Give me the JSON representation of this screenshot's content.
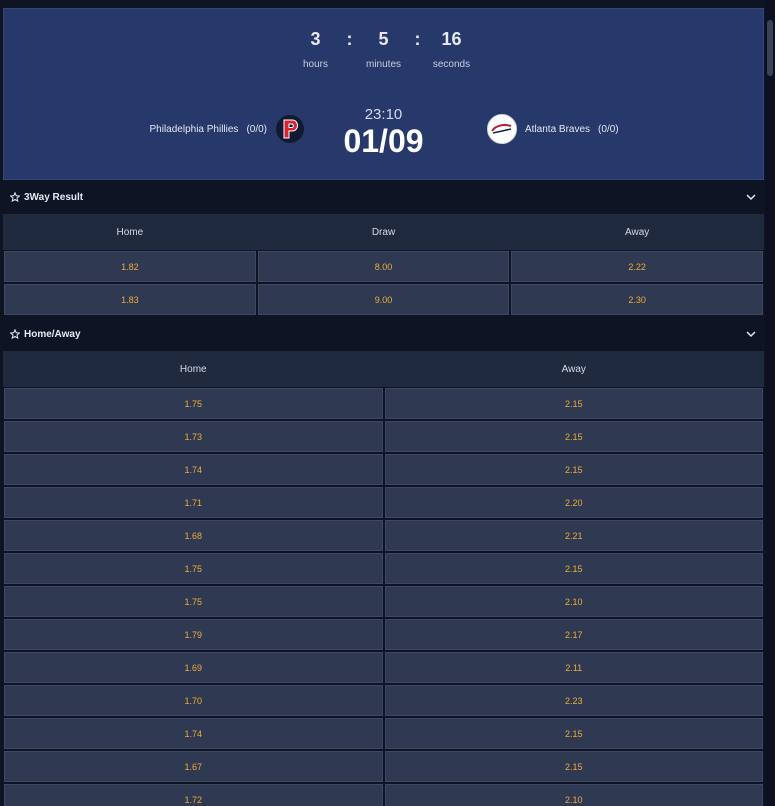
{
  "countdown": {
    "hours": "3",
    "minutes": "5",
    "seconds": "16",
    "hours_label": "hours",
    "minutes_label": "minutes",
    "seconds_label": "seconds",
    "separator": ":"
  },
  "match": {
    "home_team": "Philadelphia Phillies",
    "home_record": "(0/0)",
    "away_team": "Atlanta Braves",
    "away_record": "(0/0)",
    "time": "23:10",
    "date": "01/09"
  },
  "markets": {
    "three_way": {
      "title": "3Way Result",
      "columns": [
        "Home",
        "Draw",
        "Away"
      ],
      "rows": [
        [
          "1.82",
          "8.00",
          "2.22"
        ],
        [
          "1.83",
          "9.00",
          "2.30"
        ]
      ]
    },
    "home_away": {
      "title": "Home/Away",
      "columns": [
        "Home",
        "Away"
      ],
      "rows": [
        [
          "1.75",
          "2.15"
        ],
        [
          "1.73",
          "2.15"
        ],
        [
          "1.74",
          "2.15"
        ],
        [
          "1.71",
          "2.20"
        ],
        [
          "1.68",
          "2.21"
        ],
        [
          "1.75",
          "2.15"
        ],
        [
          "1.75",
          "2.10"
        ],
        [
          "1.79",
          "2.17"
        ],
        [
          "1.69",
          "2.11"
        ],
        [
          "1.70",
          "2.23"
        ],
        [
          "1.74",
          "2.15"
        ],
        [
          "1.67",
          "2.15"
        ],
        [
          "1.72",
          "2.10"
        ]
      ]
    }
  },
  "icons": {
    "favorite": "star-outline-icon",
    "collapse": "chevron-down-icon",
    "home_logo": "phillies-logo",
    "away_logo": "braves-logo"
  },
  "colors": {
    "odds": "#f0a93a",
    "header_bg": "#27396a",
    "page_bg": "#0f1424",
    "cell_bg": "#2f3a52"
  }
}
